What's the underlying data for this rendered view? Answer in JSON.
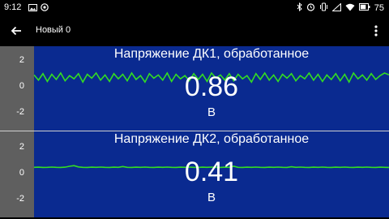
{
  "status_bar": {
    "time": "9:12",
    "left_icons": [
      "image-icon",
      "whatsapp-icon"
    ],
    "right_icons": [
      "bluetooth-icon",
      "alarm-icon",
      "vibrate-icon",
      "signal-icon",
      "wifi-icon",
      "battery-icon"
    ],
    "battery": "75"
  },
  "app_bar": {
    "title": "Новый 0"
  },
  "colors": {
    "plot_bg": "#0a2a90",
    "axis_bg": "#5f5f5f",
    "series_line": "#33dd22"
  },
  "panels": [
    {
      "title": "Напряжение ДК1, обработанное",
      "value": "0.86",
      "unit": "В",
      "y_ticks": [
        "2",
        "0",
        "-2"
      ]
    },
    {
      "title": "Напряжение ДК2, обработанное",
      "value": "0.41",
      "unit": "В",
      "y_ticks": [
        "2",
        "0",
        "-2"
      ]
    }
  ],
  "chart_data": [
    {
      "type": "line",
      "ylim": [
        -3,
        3
      ],
      "series": [
        {
          "values": [
            0.85,
            0.45,
            0.95,
            0.35,
            0.9,
            0.5,
            1.0,
            0.4,
            0.8,
            0.55,
            0.95,
            0.3,
            0.9,
            0.6,
            1.0,
            0.45,
            0.85,
            0.35,
            0.95,
            0.55,
            0.9,
            0.4,
            1.0,
            0.5,
            0.8,
            0.3,
            0.95,
            0.6,
            0.85,
            0.45,
            1.0,
            0.35,
            0.9,
            0.55,
            0.8,
            0.4,
            0.95,
            0.5,
            0.9,
            0.35,
            1.0,
            0.6,
            0.85,
            0.45,
            0.95,
            0.4,
            0.9,
            0.55,
            0.8,
            0.3,
            0.95,
            0.5,
            1.0,
            0.45,
            0.85,
            0.35,
            0.9,
            0.6,
            0.95,
            0.4,
            0.8,
            0.55,
            1.0,
            0.45,
            0.9,
            0.35,
            0.85,
            0.5,
            0.95,
            0.4,
            0.9,
            0.3,
            1.0,
            0.55,
            0.85,
            0.45,
            0.95,
            0.5,
            0.8,
            1.0,
            0.86
          ]
        }
      ]
    },
    {
      "type": "line",
      "ylim": [
        -3,
        3
      ],
      "series": [
        {
          "values": [
            0.42,
            0.43,
            0.41,
            0.42,
            0.44,
            0.42,
            0.41,
            0.43,
            0.5,
            0.55,
            0.45,
            0.42,
            0.41,
            0.43,
            0.42,
            0.44,
            0.42,
            0.41,
            0.43,
            0.42,
            0.48,
            0.42,
            0.41,
            0.43,
            0.42,
            0.44,
            0.42,
            0.41,
            0.43,
            0.42,
            0.44,
            0.42,
            0.41,
            0.43,
            0.42,
            0.44,
            0.42,
            0.41,
            0.43,
            0.42,
            0.44,
            0.42,
            0.41,
            0.43,
            0.42,
            0.5,
            0.42,
            0.41,
            0.43,
            0.42,
            0.44,
            0.42,
            0.41,
            0.43,
            0.42,
            0.44,
            0.42,
            0.41,
            0.46,
            0.42,
            0.44,
            0.42,
            0.41,
            0.43,
            0.42,
            0.44,
            0.42,
            0.41,
            0.43,
            0.42,
            0.44,
            0.42,
            0.41,
            0.43,
            0.42,
            0.44,
            0.42,
            0.41,
            0.43,
            0.42,
            0.41
          ]
        }
      ]
    }
  ]
}
